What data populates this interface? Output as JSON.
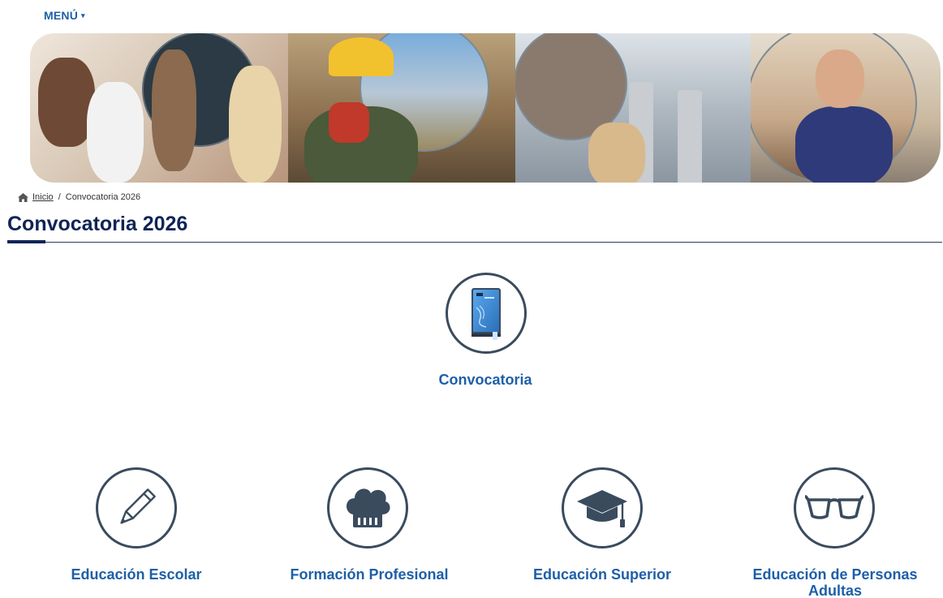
{
  "menu": {
    "label": "MENÚ",
    "caret": "▾"
  },
  "breadcrumb": {
    "home_label": "Inicio",
    "separator": "/",
    "current": "Convocatoria 2026"
  },
  "page": {
    "title": "Convocatoria 2026"
  },
  "featured": {
    "label": "Convocatoria",
    "icon": "book-icon"
  },
  "sectors": [
    {
      "label": "Educación Escolar",
      "icon": "pencil-icon"
    },
    {
      "label": "Formación Profesional",
      "icon": "chef-hat-icon"
    },
    {
      "label": "Educación Superior",
      "icon": "graduation-cap-icon"
    },
    {
      "label": "Educación de Personas Adultas",
      "icon": "glasses-icon"
    }
  ],
  "colors": {
    "link": "#1e5fa8",
    "title": "#0f2456",
    "icon_stroke": "#3a4b5e"
  }
}
